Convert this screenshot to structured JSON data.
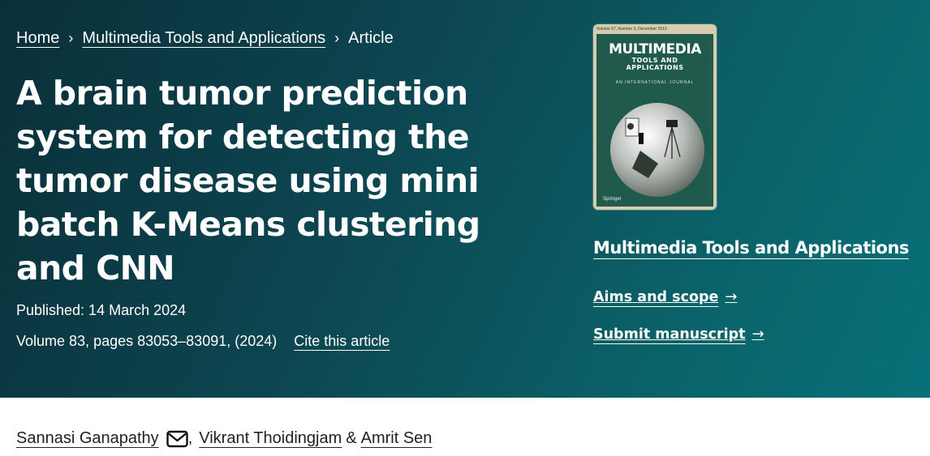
{
  "breadcrumb": {
    "home": "Home",
    "journal": "Multimedia Tools and Applications",
    "current": "Article",
    "separator": "›"
  },
  "article": {
    "title": "A brain tumor prediction system for detecting the tumor disease using mini batch K-Means clustering and CNN",
    "published": "Published: 14 March 2024",
    "volume": "Volume 83, pages 83053–83091, (2024)",
    "cite_label": "Cite this article"
  },
  "cover": {
    "top_line": "Volume 67, Number 3, December 2013",
    "journal_big": "MULTIMEDIA",
    "journal_small_1": "TOOLS AND",
    "journal_small_2": "APPLICATIONS",
    "subtitle": "AN INTERNATIONAL JOURNAL",
    "publisher": "Springer"
  },
  "sidebar": {
    "journal_link": "Multimedia Tools and Applications",
    "aims_label": "Aims and scope",
    "submit_label": "Submit manuscript",
    "arrow": "→"
  },
  "authors": {
    "a1": "Sannasi Ganapathy",
    "comma": ",",
    "a2": "Vikrant Thoidingjam",
    "amp": "&",
    "a3": "Amrit Sen",
    "mail_icon": "envelope-icon"
  },
  "colors": {
    "hero_start": "#0a2f39",
    "hero_end": "#087179",
    "text_light": "#ffffff",
    "text_dark": "#222222"
  }
}
